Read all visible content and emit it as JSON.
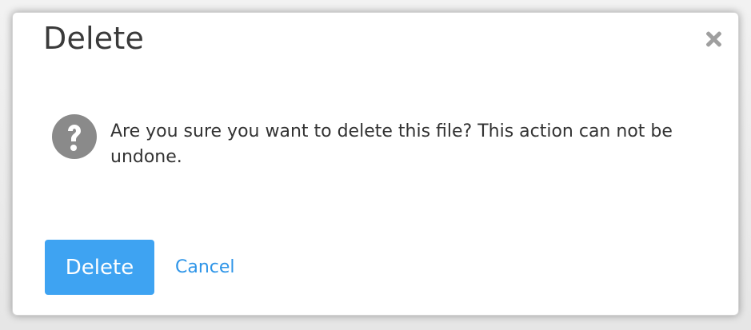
{
  "dialog": {
    "title": "Delete",
    "close_icon": "close-icon",
    "message_icon": "question-circle-icon",
    "message": "Are you sure you want to delete this file? This action can not be undone.",
    "primary_button": "Delete",
    "secondary_link": "Cancel"
  },
  "colors": {
    "primary": "#3ea3f2",
    "link": "#2e95e8",
    "icon_gray": "#8a8a8a"
  }
}
